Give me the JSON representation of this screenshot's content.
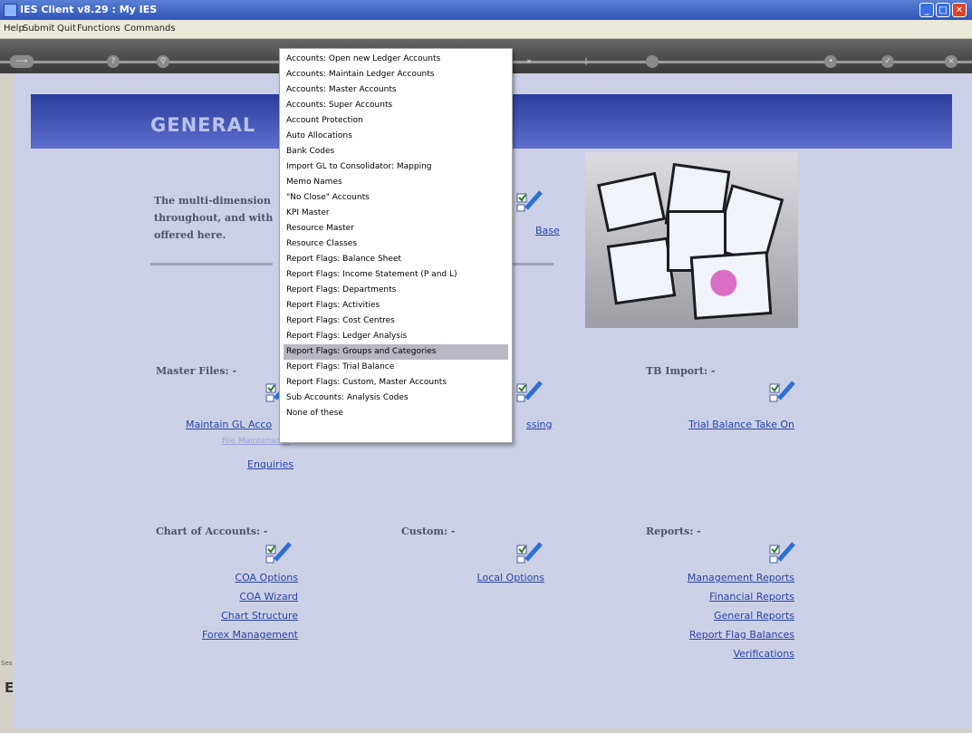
{
  "window": {
    "title": "IES Client v8.29 : My IES"
  },
  "menubar": [
    "Help",
    "Submit",
    "Quit",
    "Functions",
    "Commands"
  ],
  "page": {
    "header": "GENERAL",
    "intro": [
      "The multi-dimension",
      "throughout, and with",
      "offered here."
    ],
    "partial_link": "Base",
    "master_files": {
      "title": "Master Files: -",
      "links": [
        "Maintain GL Acco",
        "File Maintenance",
        "Enquiries"
      ]
    },
    "mid_top": {
      "link": "ssing"
    },
    "tb_import": {
      "title": "TB Import: -",
      "links": [
        "Trial Balance Take On"
      ]
    },
    "chart_of_accounts": {
      "title": "Chart of Accounts: -",
      "links": [
        "COA Options",
        "COA Wizard",
        "Chart Structure",
        "Forex Management"
      ]
    },
    "custom": {
      "title": "Custom: -",
      "links": [
        "Local Options"
      ]
    },
    "reports": {
      "title": "Reports: -",
      "links": [
        "Management Reports",
        "Financial Reports",
        "General Reports",
        "Report Flag Balances",
        "Verifications"
      ]
    }
  },
  "dropdown": {
    "highlighted_index": 19,
    "items": [
      "Accounts: Open new Ledger Accounts",
      "Accounts: Maintain Ledger Accounts",
      "Accounts: Master Accounts",
      "Accounts: Super Accounts",
      "Account Protection",
      "Auto Allocations",
      "Bank Codes",
      "Import GL to Consolidator: Mapping",
      "Memo Names",
      "\"No Close\" Accounts",
      "KPI Master",
      "Resource Master",
      "Resource Classes",
      "Report Flags: Balance Sheet",
      "Report Flags: Income Statement (P and L)",
      "Report Flags: Departments",
      "Report Flags: Activities",
      "Report Flags: Cost Centres",
      "Report Flags: Ledger Analysis",
      "Report Flags: Groups and Categories",
      "Report Flags: Trial Balance",
      "Report Flags: Custom, Master Accounts",
      "Sub Accounts: Analysis Codes",
      "None of these"
    ]
  },
  "sidebar": {
    "letter": "E",
    "label": "Ses"
  }
}
